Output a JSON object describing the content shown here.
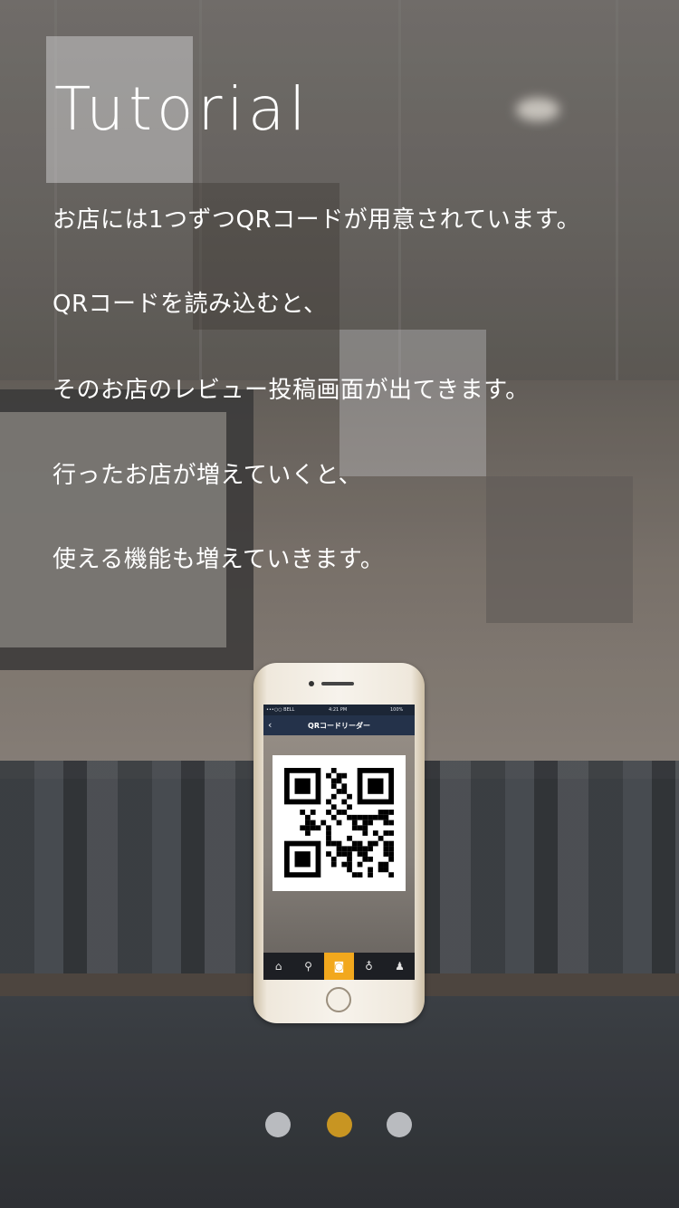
{
  "tutorial": {
    "title": "Tutorial",
    "lines": [
      "お店には1つずつQRコードが用意されています。",
      "QRコードを読み込むと、",
      "そのお店のレビュー投稿画面が出てきます。",
      "行ったお店が増えていくと、",
      "使える機能も増えていきます。"
    ]
  },
  "phone": {
    "status": {
      "carrier": "•••○○ BELL",
      "time": "4:21 PM",
      "battery": "100%"
    },
    "nav": {
      "back_icon": "chevron-left-icon",
      "title": "QRコードリーダー"
    },
    "tabs": [
      {
        "icon": "home-icon",
        "glyph": "⌂",
        "active": false
      },
      {
        "icon": "search-icon",
        "glyph": "⚲",
        "active": false
      },
      {
        "icon": "camera-icon",
        "glyph": "◙",
        "active": true
      },
      {
        "icon": "lightbulb-icon",
        "glyph": "♁",
        "active": false
      },
      {
        "icon": "person-icon",
        "glyph": "♟",
        "active": false
      }
    ]
  },
  "pagination": {
    "count": 3,
    "current": 2,
    "active_color": "#c89522",
    "inactive_color": "#b9bbbf"
  }
}
